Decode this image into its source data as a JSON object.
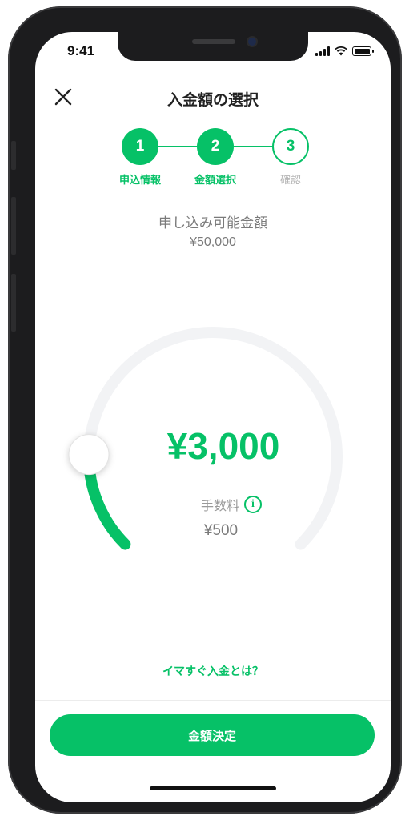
{
  "status_bar": {
    "time": "9:41"
  },
  "header": {
    "title": "入金額の選択",
    "close_icon": "close-icon"
  },
  "stepper": {
    "steps": [
      {
        "number": "1",
        "label": "申込情報",
        "state": "done"
      },
      {
        "number": "2",
        "label": "金額選択",
        "state": "done"
      },
      {
        "number": "3",
        "label": "確認",
        "state": "todo"
      }
    ]
  },
  "available": {
    "label": "申し込み可能金額",
    "value": "¥50,000"
  },
  "dial": {
    "amount": "¥3,000",
    "level_fraction": 0.17,
    "fee_label": "手数料",
    "fee_value": "¥500",
    "info_icon": "i"
  },
  "info_link": "イマすぐ入金とは？",
  "confirm_button": "金額決定",
  "colors": {
    "accent": "#06c167",
    "track": "#f2f3f5",
    "text_muted": "#7a7a7a"
  }
}
